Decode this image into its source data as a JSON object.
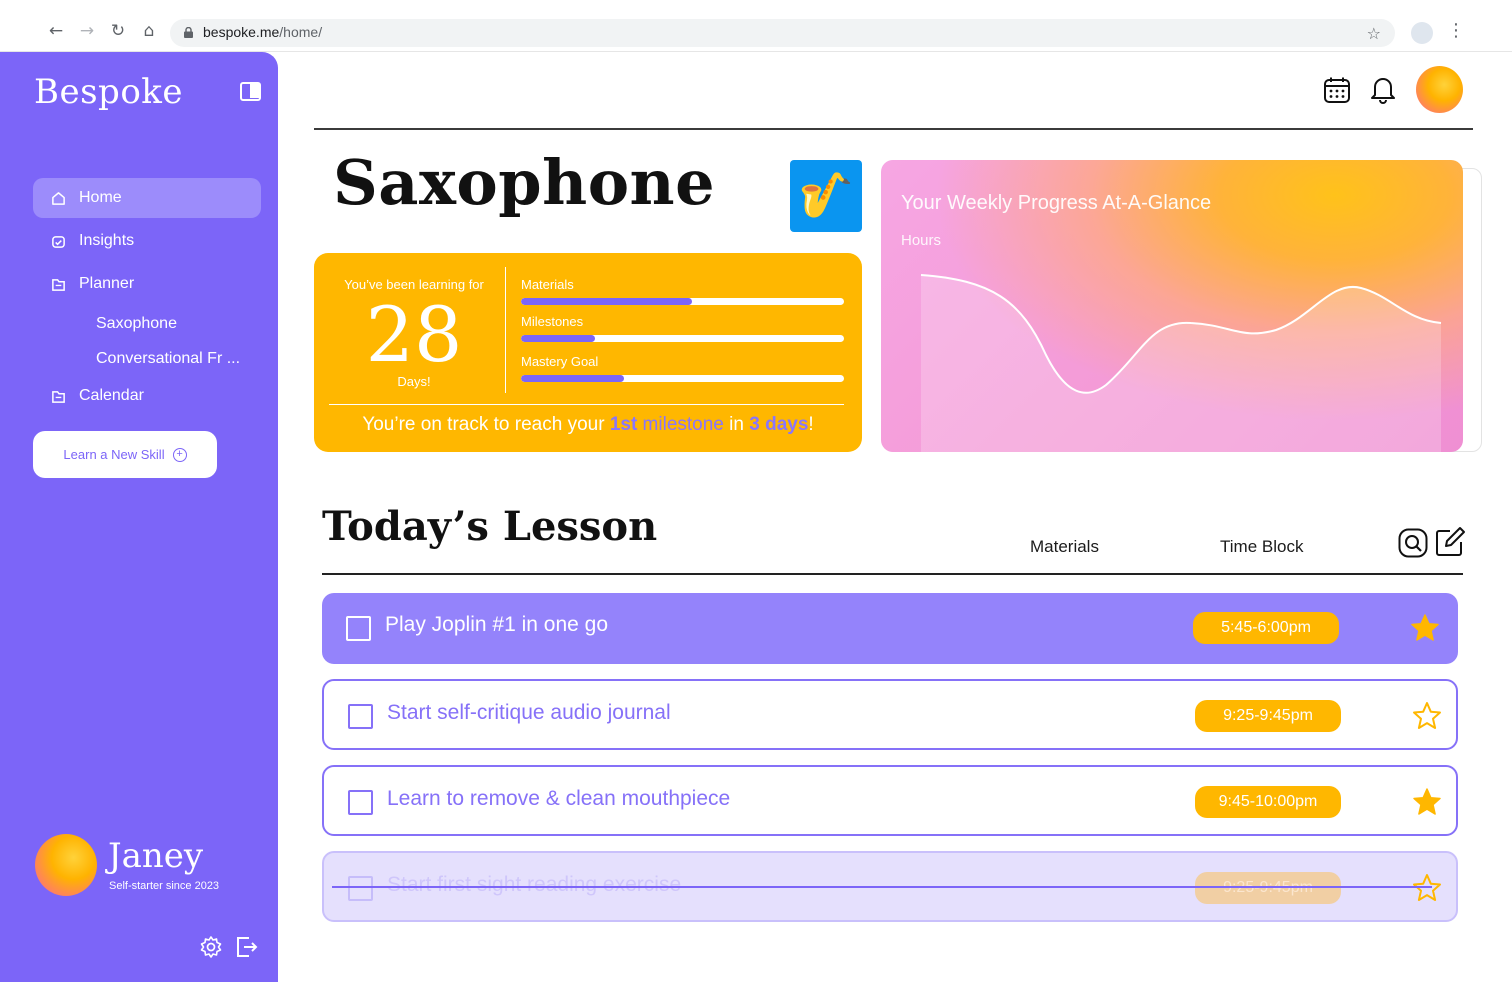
{
  "browser": {
    "url_host": "bespoke.me",
    "url_path": "/home/"
  },
  "sidebar": {
    "brand": "Bespoke",
    "items": [
      {
        "label": "Home",
        "active": true,
        "icon": "home-icon"
      },
      {
        "label": "Insights",
        "active": false,
        "icon": "insights-icon"
      },
      {
        "label": "Planner",
        "active": false,
        "icon": "planner-icon"
      },
      {
        "label": "Calendar",
        "active": false,
        "icon": "calendar-folder-icon"
      }
    ],
    "planner_sub": [
      "Saxophone",
      "Conversational Fr ..."
    ],
    "learn_button": "Learn a New Skill",
    "user": {
      "name": "Janey",
      "subtitle": "Self-starter since 2023"
    }
  },
  "skill": {
    "title": "Saxophone",
    "icon": "saxophone-icon"
  },
  "progress": {
    "learning_for_label": "You’ve been learning for",
    "days": "28",
    "days_label": "Days!",
    "bars": [
      {
        "label": "Materials",
        "value": 0.53
      },
      {
        "label": "Milestones",
        "value": 0.23
      },
      {
        "label": "Mastery Goal",
        "value": 0.32
      }
    ],
    "msg_a": "You’re on track to reach your ",
    "msg_b": "1st",
    "msg_c": " milestone",
    "msg_d": " in ",
    "msg_e": "3 days",
    "msg_f": "!"
  },
  "weekly": {
    "title": "Your Weekly Progress At-A-Glance",
    "subtitle": "Hours"
  },
  "lesson": {
    "title": "Today’s Lesson",
    "col_materials": "Materials",
    "col_time": "Time Block",
    "tasks": [
      {
        "text": "Play Joplin #1  in one go",
        "time": "5:45-6:00pm",
        "starred": true,
        "state": "active"
      },
      {
        "text": "Start self-critique audio journal",
        "time": "9:25-9:45pm",
        "starred": false,
        "state": "open"
      },
      {
        "text": "Learn to remove & clean mouthpiece",
        "time": "9:45-10:00pm",
        "starred": true,
        "state": "open"
      },
      {
        "text": "Start first sight reading exercise",
        "time": "9:25-9:45pm",
        "starred": false,
        "state": "done"
      }
    ]
  },
  "colors": {
    "accent": "#7c65f8",
    "highlight": "#ffb700",
    "card_pink": "#f49ad6"
  }
}
